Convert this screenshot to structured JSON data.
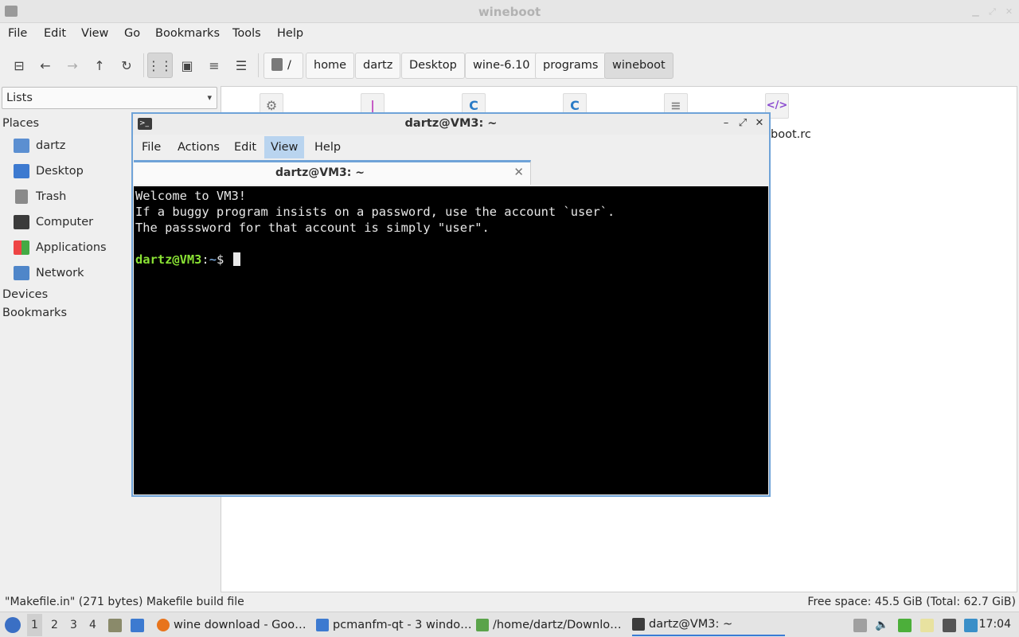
{
  "fm": {
    "title": "wineboot",
    "menu": [
      "File",
      "Edit",
      "View",
      "Go",
      "Bookmarks",
      "Tools",
      "Help"
    ],
    "breadcrumbs": [
      "/",
      "home",
      "dartz",
      "Desktop",
      "wine-6.10",
      "programs",
      "wineboot"
    ],
    "view_select": "Lists",
    "sidebar": {
      "places_label": "Places",
      "places": [
        "dartz",
        "Desktop",
        "Trash",
        "Computer",
        "Applications",
        "Network"
      ],
      "devices_label": "Devices",
      "bookmarks_label": "Bookmarks"
    },
    "files": {
      "visible_label": "boot.rc"
    },
    "status_left": "\"Makefile.in\" (271 bytes) Makefile build file",
    "status_right": "Free space: 45.5 GiB (Total: 62.7 GiB)"
  },
  "terminal": {
    "title": "dartz@VM3: ~",
    "menu": [
      "File",
      "Actions",
      "Edit",
      "View",
      "Help"
    ],
    "menu_highlighted": "View",
    "tab_label": "dartz@VM3: ~",
    "lines": [
      "Welcome to VM3!",
      "If a buggy program insists on a password, use the account `user`.",
      "The passsword for that account is simply \"user\"."
    ],
    "prompt_user": "dartz@VM3",
    "prompt_sep": ":",
    "prompt_path": "~",
    "prompt_symbol": "$"
  },
  "taskbar": {
    "desktops": [
      "1",
      "2",
      "3",
      "4"
    ],
    "tasks": [
      "wine download - Goo…",
      "pcmanfm-qt - 3 windo…",
      "/home/dartz/Downlo…",
      "dartz@VM3: ~"
    ],
    "clock": "17:04"
  },
  "colors": {
    "accent": "#6fa3d8",
    "prompt_user": "#8ae234",
    "prompt_path": "#729fcf"
  }
}
